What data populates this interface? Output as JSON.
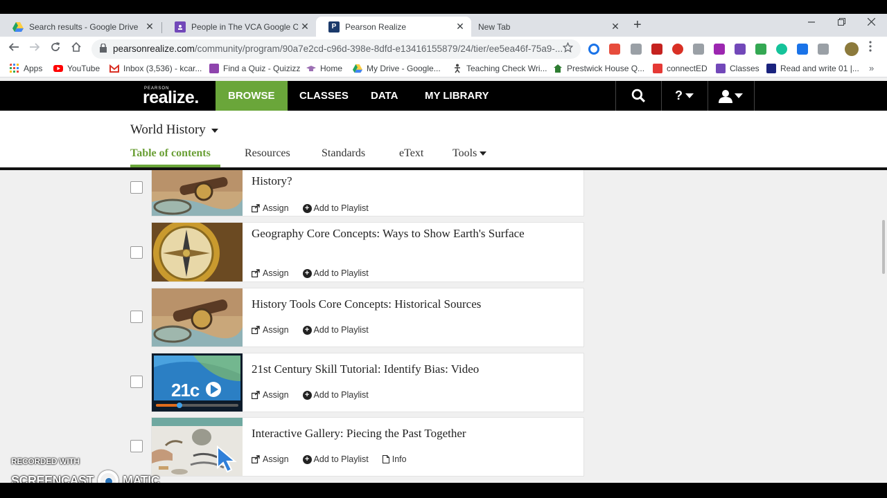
{
  "browser": {
    "tabs": [
      {
        "title": "Search results - Google Drive",
        "favicon": "google-drive-icon",
        "color": "#1fa463"
      },
      {
        "title": "People in The VCA Google Classr",
        "favicon": "google-classroom-icon",
        "color": "#7248b9"
      },
      {
        "title": "Pearson Realize",
        "favicon": "pearson-icon",
        "color": "#1b3a6b",
        "active": true
      },
      {
        "title": "New Tab",
        "favicon": "",
        "color": ""
      }
    ],
    "close_glyph": "✕",
    "new_tab_glyph": "+",
    "url_host": "pearsonrealize.com",
    "url_path": "/community/program/90a7e2cd-c96d-398e-8dfd-e13416155879/24/tier/ee5ea46f-75a9-...",
    "bookmarks": [
      {
        "label": "Apps",
        "icon": "apps-grid-icon",
        "color": "#e8453c"
      },
      {
        "label": "YouTube",
        "icon": "youtube-icon",
        "color": "#ff0000"
      },
      {
        "label": "Inbox (3,536) - kcar...",
        "icon": "gmail-icon",
        "color": "#d93025"
      },
      {
        "label": "Find a Quiz - Quizizz",
        "icon": "quizizz-icon",
        "color": "#8e44ad"
      },
      {
        "label": "Home",
        "icon": "home-hat-icon",
        "color": "#9c6fb3"
      },
      {
        "label": "My Drive - Google...",
        "icon": "google-drive-icon",
        "color": "#1fa463"
      },
      {
        "label": "Teaching Check Wri...",
        "icon": "figure-icon",
        "color": "#444444"
      },
      {
        "label": "Prestwick House Q...",
        "icon": "prestwick-icon",
        "color": "#2e7d32"
      },
      {
        "label": "connectED",
        "icon": "connected-icon",
        "color": "#e53935"
      },
      {
        "label": "Classes",
        "icon": "google-classroom-icon",
        "color": "#7248b9"
      },
      {
        "label": "Read and write 01 |...",
        "icon": "read-write-icon",
        "color": "#1a237e"
      }
    ]
  },
  "app": {
    "logo_small": "PEARSON",
    "logo_big": "realize.",
    "nav": [
      "BROWSE",
      "CLASSES",
      "DATA",
      "MY LIBRARY"
    ],
    "help_glyph": "?",
    "program": "World History",
    "subtabs": [
      "Table of contents",
      "Resources",
      "Standards",
      "eText",
      "Tools"
    ],
    "accent": "#6aa63a"
  },
  "items": [
    {
      "title": "History?",
      "actions": [
        "Assign",
        "Add to Playlist"
      ],
      "thumb": "compass-map-thumbnail"
    },
    {
      "title": "Geography Core Concepts: Ways to Show Earth's Surface",
      "actions": [
        "Assign",
        "Add to Playlist"
      ],
      "thumb": "compass-thumbnail"
    },
    {
      "title": "History Tools Core Concepts: Historical Sources",
      "actions": [
        "Assign",
        "Add to Playlist"
      ],
      "thumb": "compass-map-thumbnail"
    },
    {
      "title": "21st Century Skill Tutorial: Identify Bias: Video",
      "actions": [
        "Assign",
        "Add to Playlist"
      ],
      "thumb": "video-21c-thumbnail",
      "thumb_text": "21c"
    },
    {
      "title": "Interactive Gallery: Piecing the Past Together",
      "actions": [
        "Assign",
        "Add to Playlist",
        "Info"
      ],
      "thumb": "artifacts-thumbnail"
    }
  ],
  "watermark": {
    "line1": "RECORDED WITH",
    "left": "SCREENCAST",
    "right": "MATIC"
  }
}
